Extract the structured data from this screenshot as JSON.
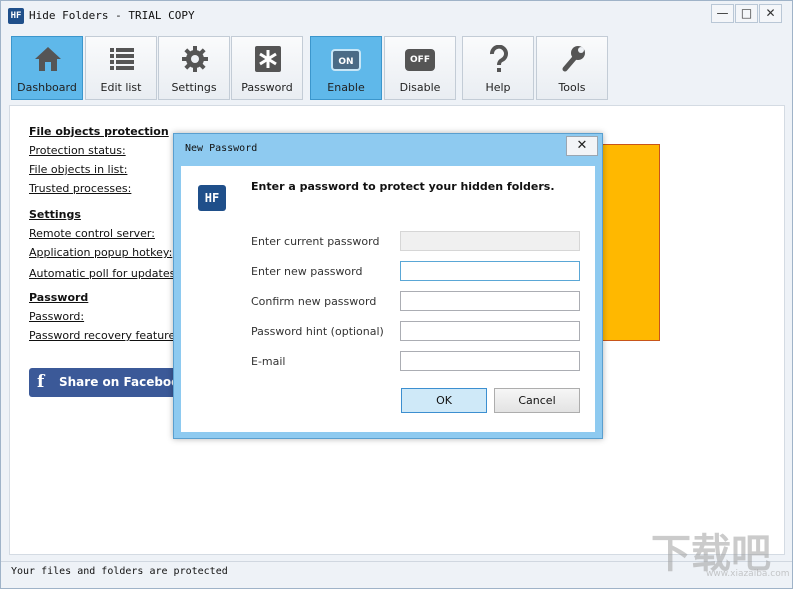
{
  "window": {
    "title": "Hide Folders - TRIAL COPY",
    "icon_text": "HF",
    "minimize": "—",
    "maximize": "□",
    "close": "✕"
  },
  "toolbar": {
    "items": [
      {
        "label": "Dashboard",
        "icon": "home-icon"
      },
      {
        "label": "Edit list",
        "icon": "list-icon"
      },
      {
        "label": "Settings",
        "icon": "gear-icon"
      },
      {
        "label": "Password",
        "icon": "asterisk-icon"
      },
      {
        "label": "Enable",
        "icon": "on-switch-icon",
        "switch_text": "ON"
      },
      {
        "label": "Disable",
        "icon": "off-switch-icon",
        "switch_text": "OFF"
      },
      {
        "label": "Help",
        "icon": "question-icon"
      },
      {
        "label": "Tools",
        "icon": "wrench-icon"
      }
    ],
    "active": [
      "Dashboard",
      "Enable"
    ]
  },
  "dashboard": {
    "sections": [
      {
        "heading": "File objects protection",
        "items": [
          "Protection status:",
          "File objects in list:",
          "Trusted processes:"
        ]
      },
      {
        "heading": "Settings",
        "items": [
          "Remote control server:",
          "Application popup hotkey:",
          "Automatic poll for updates:"
        ]
      },
      {
        "heading": "Password",
        "items": [
          "Password:",
          "Password recovery feature:"
        ]
      }
    ],
    "facebook_label": "Share on Facebook",
    "facebook_glyph": "f"
  },
  "dialog": {
    "title": "New Password",
    "close": "✕",
    "logo_text": "HF",
    "heading": "Enter a password to protect your hidden folders.",
    "fields": [
      {
        "label": "Enter current password",
        "value": "",
        "disabled": true
      },
      {
        "label": "Enter new password",
        "value": "",
        "focused": true
      },
      {
        "label": "Confirm new password",
        "value": ""
      },
      {
        "label": "Password hint (optional)",
        "value": ""
      },
      {
        "label": "E-mail",
        "value": ""
      }
    ],
    "ok_label": "OK",
    "cancel_label": "Cancel"
  },
  "statusbar": {
    "text": "Your files and folders are protected"
  },
  "watermark": {
    "main": "下载吧",
    "sub": "www.xiazaiba.com"
  },
  "colors": {
    "active_button": "#5fb8ea",
    "dialog_frame": "#8ecaf0",
    "status_box": "#ffb800",
    "facebook": "#3b5998"
  }
}
